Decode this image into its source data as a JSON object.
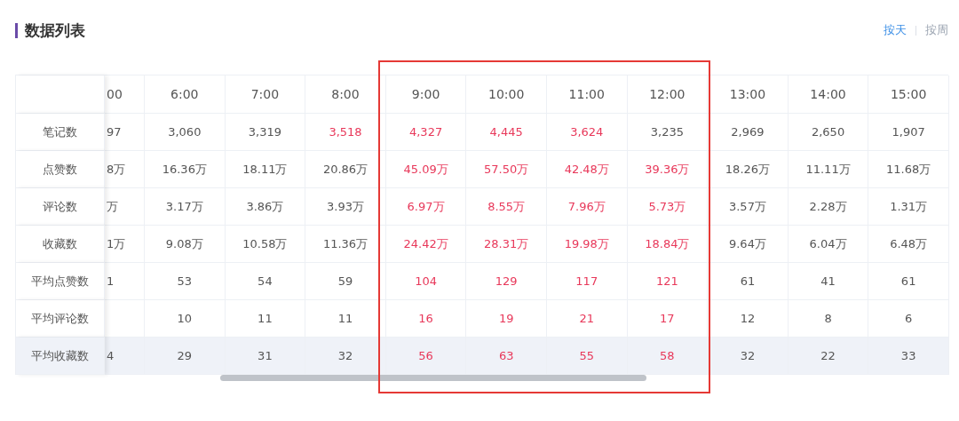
{
  "title": "数据列表",
  "tabs": [
    {
      "label": "按天",
      "selected": true
    },
    {
      "label": "按周",
      "selected": false
    }
  ],
  "table": {
    "columns": [
      {
        "label": "00",
        "partial": true,
        "framed": false
      },
      {
        "label": "6:00",
        "partial": false,
        "framed": false
      },
      {
        "label": "7:00",
        "partial": false,
        "framed": false
      },
      {
        "label": "8:00",
        "partial": false,
        "framed": false
      },
      {
        "label": "9:00",
        "partial": false,
        "framed": true
      },
      {
        "label": "10:00",
        "partial": false,
        "framed": true
      },
      {
        "label": "11:00",
        "partial": false,
        "framed": true
      },
      {
        "label": "12:00",
        "partial": false,
        "framed": true
      },
      {
        "label": "13:00",
        "partial": false,
        "framed": false
      },
      {
        "label": "14:00",
        "partial": false,
        "framed": false
      },
      {
        "label": "15:00",
        "partial": false,
        "framed": false
      }
    ],
    "rows": [
      {
        "label": "笔记数",
        "hovered": false,
        "cells": [
          {
            "text": "97",
            "highlight": false
          },
          {
            "text": "3,060",
            "highlight": false
          },
          {
            "text": "3,319",
            "highlight": false
          },
          {
            "text": "3,518",
            "highlight": true
          },
          {
            "text": "4,327",
            "highlight": true
          },
          {
            "text": "4,445",
            "highlight": true
          },
          {
            "text": "3,624",
            "highlight": true
          },
          {
            "text": "3,235",
            "highlight": false
          },
          {
            "text": "2,969",
            "highlight": false
          },
          {
            "text": "2,650",
            "highlight": false
          },
          {
            "text": "1,907",
            "highlight": false
          }
        ]
      },
      {
        "label": "点赞数",
        "hovered": false,
        "cells": [
          {
            "text": "8万",
            "highlight": false
          },
          {
            "text": "16.36万",
            "highlight": false
          },
          {
            "text": "18.11万",
            "highlight": false
          },
          {
            "text": "20.86万",
            "highlight": false
          },
          {
            "text": "45.09万",
            "highlight": true
          },
          {
            "text": "57.50万",
            "highlight": true
          },
          {
            "text": "42.48万",
            "highlight": true
          },
          {
            "text": "39.36万",
            "highlight": true
          },
          {
            "text": "18.26万",
            "highlight": false
          },
          {
            "text": "11.11万",
            "highlight": false
          },
          {
            "text": "11.68万",
            "highlight": false
          }
        ]
      },
      {
        "label": "评论数",
        "hovered": false,
        "cells": [
          {
            "text": "万",
            "highlight": false
          },
          {
            "text": "3.17万",
            "highlight": false
          },
          {
            "text": "3.86万",
            "highlight": false
          },
          {
            "text": "3.93万",
            "highlight": false
          },
          {
            "text": "6.97万",
            "highlight": true
          },
          {
            "text": "8.55万",
            "highlight": true
          },
          {
            "text": "7.96万",
            "highlight": true
          },
          {
            "text": "5.73万",
            "highlight": true
          },
          {
            "text": "3.57万",
            "highlight": false
          },
          {
            "text": "2.28万",
            "highlight": false
          },
          {
            "text": "1.31万",
            "highlight": false
          }
        ]
      },
      {
        "label": "收藏数",
        "hovered": false,
        "cells": [
          {
            "text": "1万",
            "highlight": false
          },
          {
            "text": "9.08万",
            "highlight": false
          },
          {
            "text": "10.58万",
            "highlight": false
          },
          {
            "text": "11.36万",
            "highlight": false
          },
          {
            "text": "24.42万",
            "highlight": true
          },
          {
            "text": "28.31万",
            "highlight": true
          },
          {
            "text": "19.98万",
            "highlight": true
          },
          {
            "text": "18.84万",
            "highlight": true
          },
          {
            "text": "9.64万",
            "highlight": false
          },
          {
            "text": "6.04万",
            "highlight": false
          },
          {
            "text": "6.48万",
            "highlight": false
          }
        ]
      },
      {
        "label": "平均点赞数",
        "hovered": false,
        "cells": [
          {
            "text": "1",
            "highlight": false
          },
          {
            "text": "53",
            "highlight": false
          },
          {
            "text": "54",
            "highlight": false
          },
          {
            "text": "59",
            "highlight": false
          },
          {
            "text": "104",
            "highlight": true
          },
          {
            "text": "129",
            "highlight": true
          },
          {
            "text": "117",
            "highlight": true
          },
          {
            "text": "121",
            "highlight": true
          },
          {
            "text": "61",
            "highlight": false
          },
          {
            "text": "41",
            "highlight": false
          },
          {
            "text": "61",
            "highlight": false
          }
        ]
      },
      {
        "label": "平均评论数",
        "hovered": false,
        "cells": [
          null,
          {
            "text": "10",
            "highlight": false
          },
          {
            "text": "11",
            "highlight": false
          },
          {
            "text": "11",
            "highlight": false
          },
          {
            "text": "16",
            "highlight": true
          },
          {
            "text": "19",
            "highlight": true
          },
          {
            "text": "21",
            "highlight": true
          },
          {
            "text": "17",
            "highlight": true
          },
          {
            "text": "12",
            "highlight": false
          },
          {
            "text": "8",
            "highlight": false
          },
          {
            "text": "6",
            "highlight": false
          }
        ]
      },
      {
        "label": "平均收藏数",
        "hovered": true,
        "cells": [
          {
            "text": "4",
            "highlight": false
          },
          {
            "text": "29",
            "highlight": false
          },
          {
            "text": "31",
            "highlight": false
          },
          {
            "text": "32",
            "highlight": false
          },
          {
            "text": "56",
            "highlight": true
          },
          {
            "text": "63",
            "highlight": true
          },
          {
            "text": "55",
            "highlight": true
          },
          {
            "text": "58",
            "highlight": true
          },
          {
            "text": "32",
            "highlight": false
          },
          {
            "text": "22",
            "highlight": false
          },
          {
            "text": "33",
            "highlight": false
          }
        ]
      }
    ]
  }
}
